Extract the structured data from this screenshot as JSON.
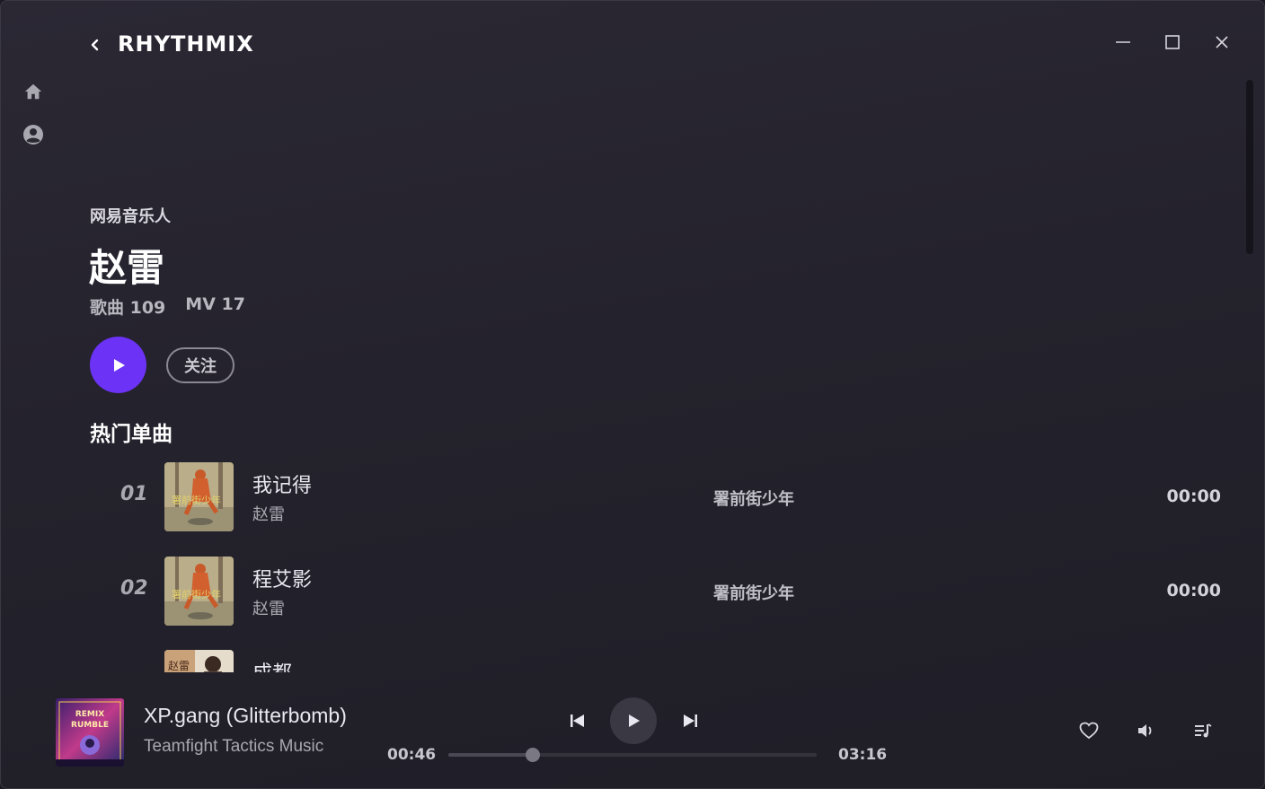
{
  "app": {
    "logo": "RHYTHMIX"
  },
  "artist": {
    "label": "网易音乐人",
    "name": "赵雷",
    "songs_stat": "歌曲 109",
    "mv_stat": "MV 17",
    "follow_label": "关注"
  },
  "section": {
    "title": "热门单曲"
  },
  "songs": [
    {
      "index": "01",
      "title": "我记得",
      "artist": "赵雷",
      "album": "署前街少年",
      "duration": "00:00"
    },
    {
      "index": "02",
      "title": "程艾影",
      "artist": "赵雷",
      "album": "署前街少年",
      "duration": "00:00"
    },
    {
      "index": "",
      "title": "成都",
      "artist": "",
      "album": "",
      "duration": ""
    }
  ],
  "player": {
    "title": "XP.gang (Glitterbomb)",
    "artist": "Teamfight Tactics Music",
    "current_time": "00:46",
    "total_time": "03:16",
    "progress": 0.23
  },
  "colors": {
    "accent": "#6c32f5",
    "background": "#24222c"
  },
  "icons": {
    "back": "chevron-left-icon",
    "minimize": "minimize-icon",
    "maximize": "maximize-icon",
    "close": "close-icon",
    "home": "home-icon",
    "user": "user-circle-icon",
    "prev": "skip-previous-icon",
    "play": "play-icon",
    "next": "skip-next-icon",
    "like": "heart-icon",
    "volume": "volume-icon",
    "playlist": "playlist-icon"
  }
}
